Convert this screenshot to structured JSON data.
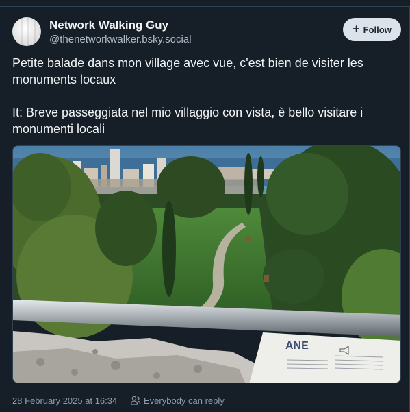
{
  "post": {
    "display_name": "Network Walking Guy",
    "handle": "@thenetworkwalker.bsky.social",
    "follow_label": "Follow",
    "text": "Petite balade dans mon village avec vue, c'est bien de visiter les monuments locaux\n\nIt: Breve passeggiata nel mio villaggio con vista, è bello visitare i monumenti locali",
    "timestamp": "28 February 2025 at 16:34",
    "reply_setting": "Everybody can reply"
  },
  "media": {
    "sign_text": "ANE"
  },
  "icons": {
    "follow": "plus-icon",
    "reply": "people-icon"
  },
  "colors": {
    "background": "#161e27",
    "follow_button": "#dce2ea",
    "muted_text": "#8d9cad"
  }
}
